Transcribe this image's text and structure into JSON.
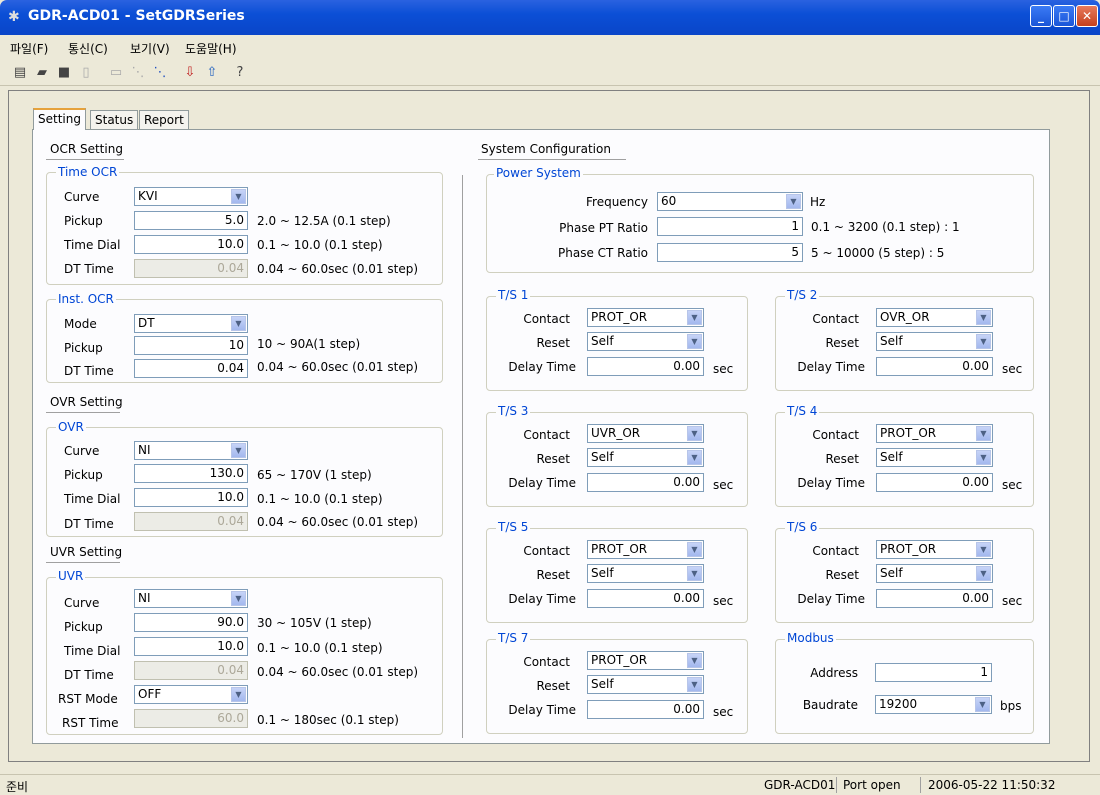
{
  "window": {
    "title": "GDR-ACD01 - SetGDRSeries"
  },
  "menu": [
    "파일(F)",
    "통신(C)",
    "보기(V)",
    "도움말(H)"
  ],
  "tabs": [
    "Setting",
    "Status",
    "Report"
  ],
  "ocr": {
    "title": "OCR Setting",
    "time_ocr": {
      "title": "Time OCR",
      "curve_label": "Curve",
      "curve": "KVI",
      "pickup_label": "Pickup",
      "pickup": "5.0",
      "pickup_hint": "2.0 ~ 12.5A (0.1 step)",
      "td_label": "Time Dial",
      "td": "10.0",
      "td_hint": "0.1 ~ 10.0 (0.1 step)",
      "dt_label": "DT Time",
      "dt": "0.04",
      "dt_hint": "0.04 ~ 60.0sec (0.01 step)"
    },
    "inst_ocr": {
      "title": "Inst. OCR",
      "mode_label": "Mode",
      "mode": "DT",
      "pickup_label": "Pickup",
      "pickup": "10",
      "pickup_hint": "10 ~ 90A(1 step)",
      "dt_label": "DT Time",
      "dt": "0.04",
      "dt_hint": "0.04 ~ 60.0sec (0.01 step)"
    }
  },
  "ovr": {
    "title": "OVR Setting",
    "group": "OVR",
    "curve_label": "Curve",
    "curve": "NI",
    "pickup_label": "Pickup",
    "pickup": "130.0",
    "pickup_hint": "65 ~ 170V (1 step)",
    "td_label": "Time Dial",
    "td": "10.0",
    "td_hint": "0.1 ~ 10.0 (0.1 step)",
    "dt_label": "DT Time",
    "dt": "0.04",
    "dt_hint": "0.04 ~ 60.0sec (0.01 step)"
  },
  "uvr": {
    "title": "UVR Setting",
    "group": "UVR",
    "curve_label": "Curve",
    "curve": "NI",
    "pickup_label": "Pickup",
    "pickup": "90.0",
    "pickup_hint": "30 ~ 105V (1 step)",
    "td_label": "Time Dial",
    "td": "10.0",
    "td_hint": "0.1 ~ 10.0 (0.1 step)",
    "dt_label": "DT Time",
    "dt": "0.04",
    "dt_hint": "0.04 ~ 60.0sec (0.01 step)",
    "rst_mode_label": "RST Mode",
    "rst_mode": "OFF",
    "rst_time_label": "RST Time",
    "rst_time": "60.0",
    "rst_time_hint": "0.1 ~ 180sec (0.1 step)"
  },
  "sys": {
    "title": "System Configuration",
    "power": {
      "title": "Power System",
      "freq_label": "Frequency",
      "freq": "60",
      "freq_unit": "Hz",
      "pt_label": "Phase PT Ratio",
      "pt": "1",
      "pt_hint": "0.1 ~ 3200 (0.1 step) : 1",
      "ct_label": "Phase CT Ratio",
      "ct": "5",
      "ct_hint": "5 ~ 10000 (5 step) : 5"
    },
    "ts": [
      {
        "title": "T/S 1",
        "contact": "PROT_OR",
        "reset": "Self",
        "delay": "0.00"
      },
      {
        "title": "T/S 2",
        "contact": "OVR_OR",
        "reset": "Self",
        "delay": "0.00"
      },
      {
        "title": "T/S 3",
        "contact": "UVR_OR",
        "reset": "Self",
        "delay": "0.00"
      },
      {
        "title": "T/S 4",
        "contact": "PROT_OR",
        "reset": "Self",
        "delay": "0.00"
      },
      {
        "title": "T/S 5",
        "contact": "PROT_OR",
        "reset": "Self",
        "delay": "0.00"
      },
      {
        "title": "T/S 6",
        "contact": "PROT_OR",
        "reset": "Self",
        "delay": "0.00"
      },
      {
        "title": "T/S 7",
        "contact": "PROT_OR",
        "reset": "Self",
        "delay": "0.00"
      }
    ],
    "ts_labels": {
      "contact": "Contact",
      "reset": "Reset",
      "delay": "Delay Time",
      "unit": "sec"
    },
    "modbus": {
      "title": "Modbus",
      "address_label": "Address",
      "address": "1",
      "baud_label": "Baudrate",
      "baud": "19200",
      "baud_unit": "bps"
    }
  },
  "status": {
    "left": "준비",
    "device": "GDR-ACD01",
    "port": "Port open",
    "datetime": "2006-05-22 11:50:32"
  }
}
